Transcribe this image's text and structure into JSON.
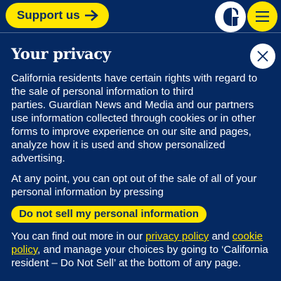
{
  "header": {
    "support_label": "Support us",
    "icons": {
      "support_arrow": "arrow-right-icon",
      "logo": "guardian-logo-icon",
      "menu": "hamburger-menu-icon"
    }
  },
  "privacy": {
    "title": "Your privacy",
    "close_icon": "close-icon",
    "paragraph1_lines": [
      "California residents have certain rights with regard to",
      "the sale of personal information to third",
      "parties. Guardian News and Media and our partners",
      "use information collected through cookies or in other",
      "forms to improve experience on our site and pages,",
      "analyze how it is used and show personalized",
      "advertising."
    ],
    "paragraph2_lines": [
      "At any point, you can opt out of the sale of all of your",
      "personal information by pressing"
    ],
    "dns_button_label": "Do not sell my personal information",
    "paragraph3": {
      "before_privacy": "You can find out more in our ",
      "privacy_link": "privacy policy",
      "between": " and ",
      "cookie_link_line1": "cookie",
      "cookie_link_line2": "policy",
      "after": ", and manage your choices by going to ‘California",
      "last_line": "resident – Do Not Sell’ at the bottom of any page."
    }
  },
  "colors": {
    "background": "#052962",
    "accent": "#ffe500",
    "text": "#ffffff"
  }
}
